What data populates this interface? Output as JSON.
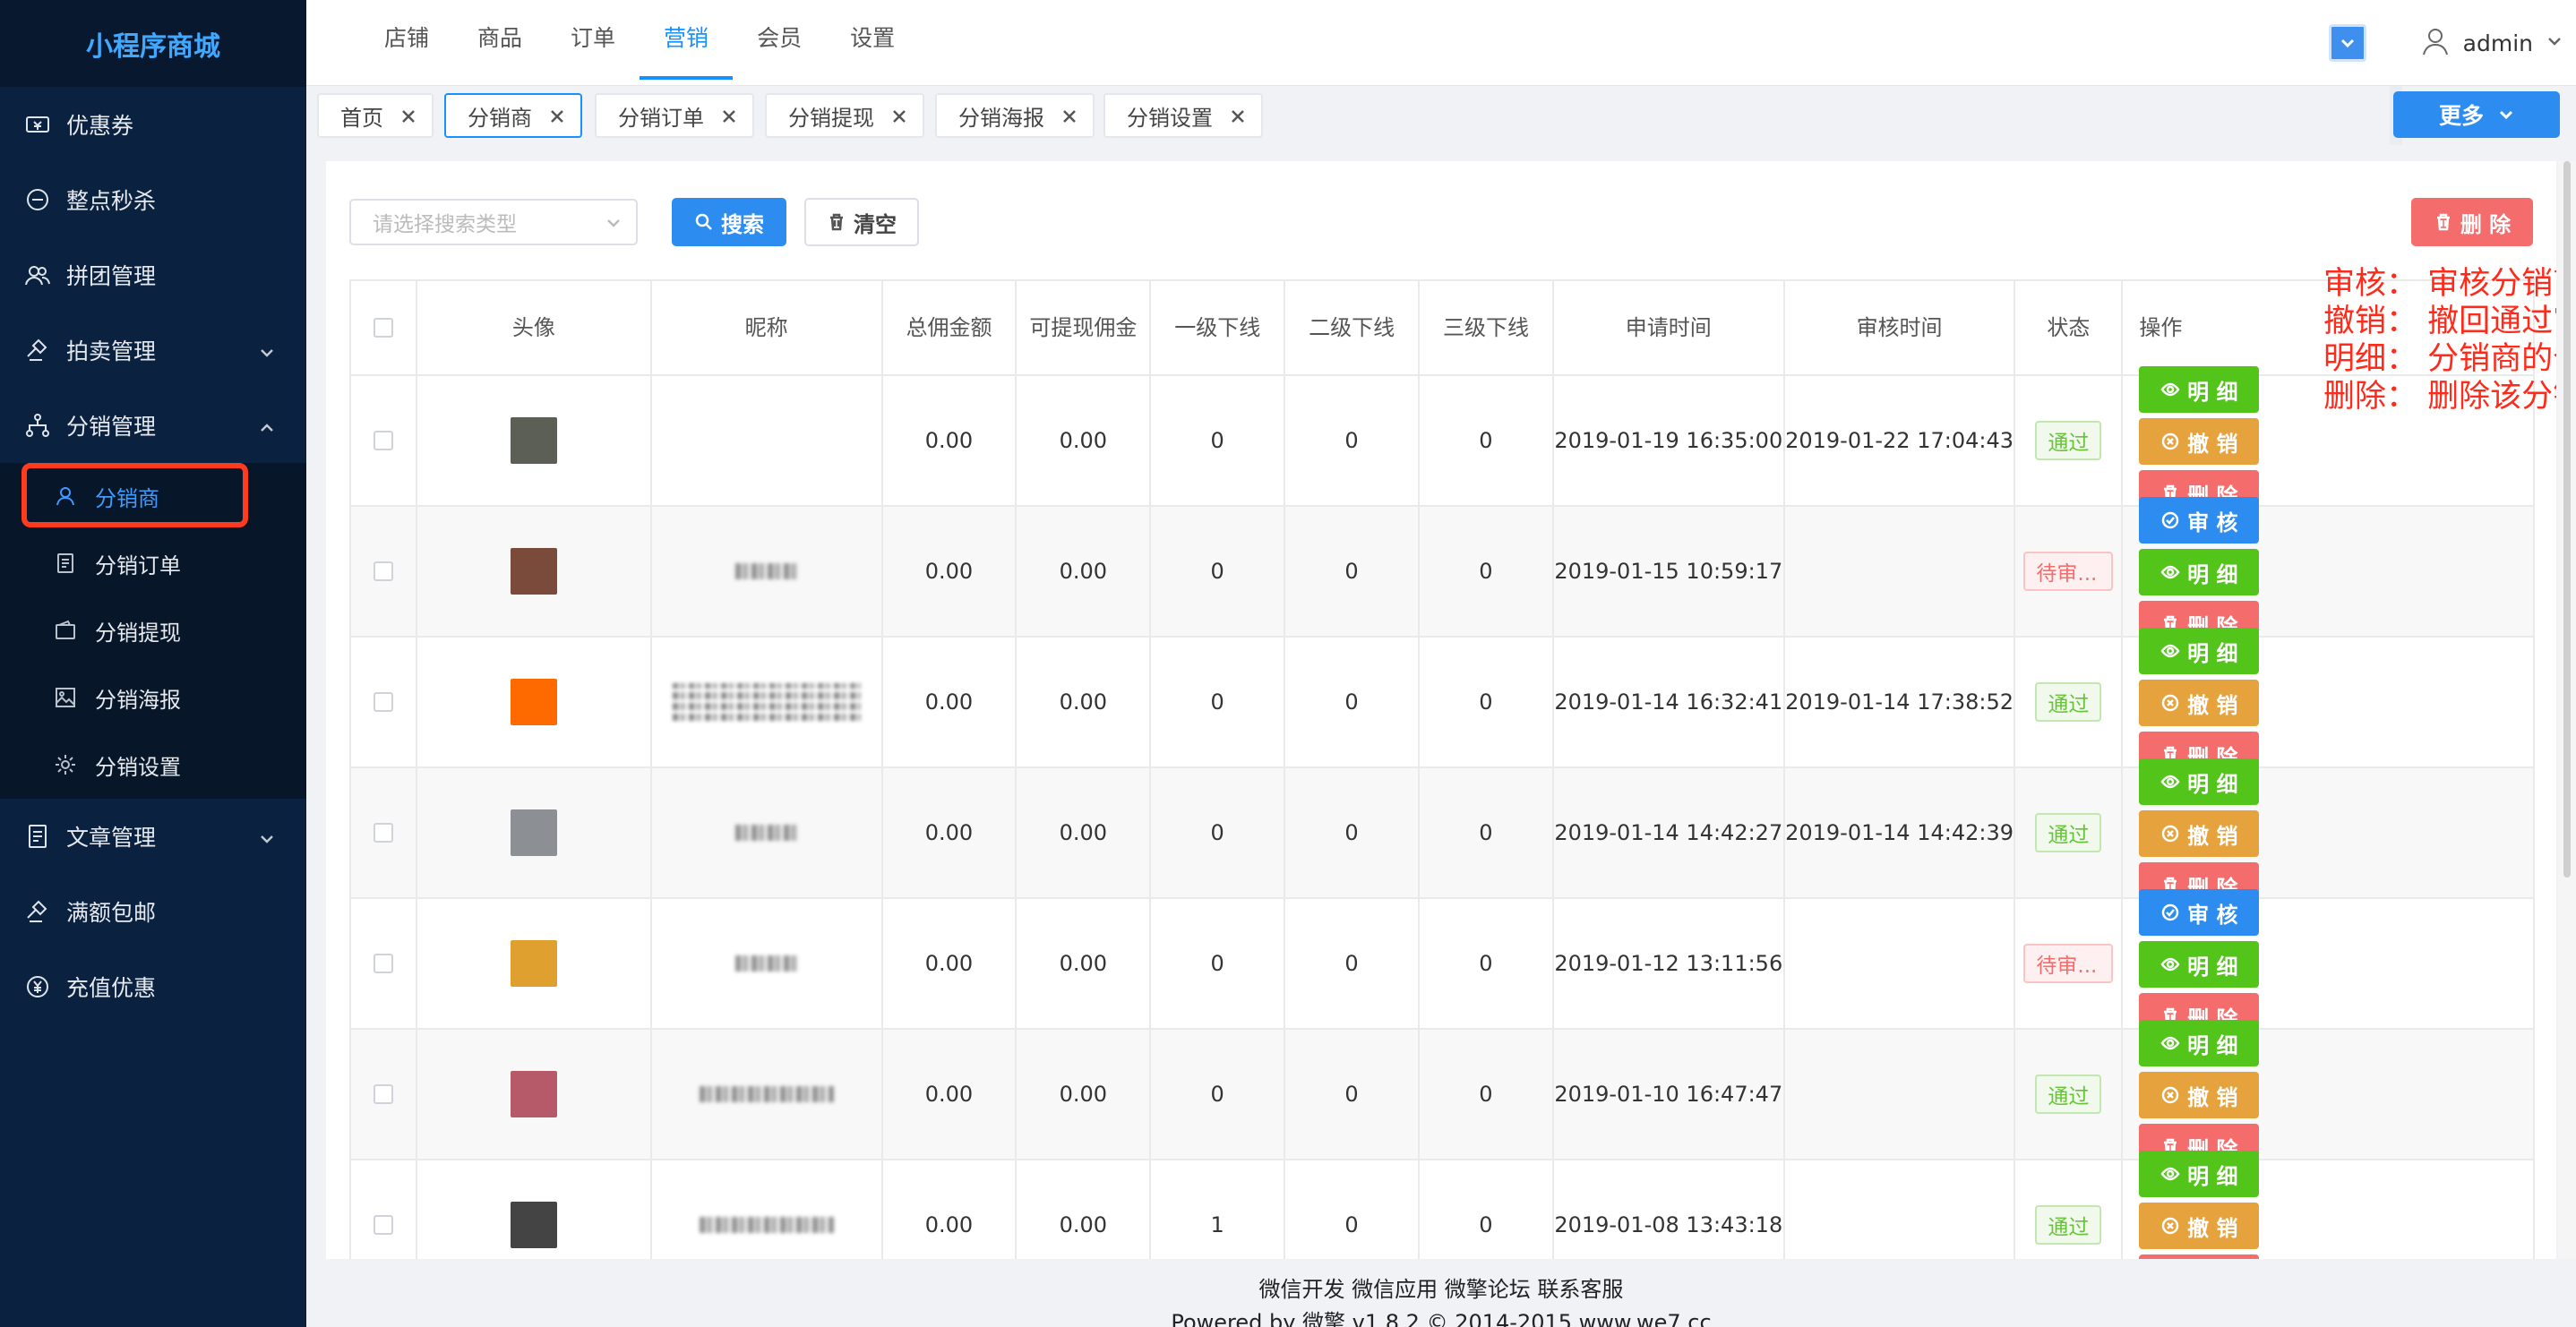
{
  "brand": "小程序商城",
  "sidebar": {
    "items": [
      {
        "label": "优惠券",
        "icon": "coupon-icon"
      },
      {
        "label": "整点秒杀",
        "icon": "flash-sale-icon"
      },
      {
        "label": "拼团管理",
        "icon": "group-icon"
      },
      {
        "label": "拍卖管理",
        "icon": "auction-icon"
      },
      {
        "label": "分销管理",
        "icon": "distribution-icon"
      },
      {
        "label": "文章管理",
        "icon": "article-icon"
      },
      {
        "label": "满额包邮",
        "icon": "shipping-icon"
      },
      {
        "label": "充值优惠",
        "icon": "recharge-icon"
      }
    ],
    "submenu": [
      {
        "label": "分销商",
        "icon": "user-icon"
      },
      {
        "label": "分销订单",
        "icon": "order-icon"
      },
      {
        "label": "分销提现",
        "icon": "wallet-icon"
      },
      {
        "label": "分销海报",
        "icon": "poster-icon"
      },
      {
        "label": "分销设置",
        "icon": "gear-icon"
      }
    ]
  },
  "header": {
    "nav": [
      "店铺",
      "商品",
      "订单",
      "营销",
      "会员",
      "设置"
    ],
    "active_nav": "营销",
    "user": "admin"
  },
  "tabs": [
    "首页",
    "分销商",
    "分销订单",
    "分销提现",
    "分销海报",
    "分销设置"
  ],
  "more_label": "更多",
  "toolbar": {
    "search_type_placeholder": "请选择搜索类型",
    "search_label": "搜索",
    "clear_label": "清空",
    "delete_label": "删 除"
  },
  "annotation": [
    "审核： 审核分销商的操作",
    "撤销： 撤回通过审核操作",
    "明细： 分销商的个人明细",
    "删除： 删除该分销商"
  ],
  "table": {
    "columns": [
      "头像",
      "昵称",
      "总佣金额",
      "可提现佣金",
      "一级下线",
      "二级下线",
      "三级下线",
      "申请时间",
      "审核时间",
      "状态",
      "操作"
    ],
    "rows": [
      {
        "total": "0.00",
        "withdrawable": "0.00",
        "l1": "0",
        "l2": "0",
        "l3": "0",
        "apply_time": "2019-01-19 16:35:00",
        "audit_time": "2019-01-22 17:04:43",
        "status": "通过"
      },
      {
        "total": "0.00",
        "withdrawable": "0.00",
        "l1": "0",
        "l2": "0",
        "l3": "0",
        "apply_time": "2019-01-15 10:59:17",
        "audit_time": "",
        "status": "待审..."
      },
      {
        "total": "0.00",
        "withdrawable": "0.00",
        "l1": "0",
        "l2": "0",
        "l3": "0",
        "apply_time": "2019-01-14 16:32:41",
        "audit_time": "2019-01-14 17:38:52",
        "status": "通过"
      },
      {
        "total": "0.00",
        "withdrawable": "0.00",
        "l1": "0",
        "l2": "0",
        "l3": "0",
        "apply_time": "2019-01-14 14:42:27",
        "audit_time": "2019-01-14 14:42:39",
        "status": "通过"
      },
      {
        "total": "0.00",
        "withdrawable": "0.00",
        "l1": "0",
        "l2": "0",
        "l3": "0",
        "apply_time": "2019-01-12 13:11:56",
        "audit_time": "",
        "status": "待审..."
      },
      {
        "total": "0.00",
        "withdrawable": "0.00",
        "l1": "0",
        "l2": "0",
        "l3": "0",
        "apply_time": "2019-01-10 16:47:47",
        "audit_time": "",
        "status": "通过"
      },
      {
        "total": "0.00",
        "withdrawable": "0.00",
        "l1": "1",
        "l2": "0",
        "l3": "0",
        "apply_time": "2019-01-08 13:43:18",
        "audit_time": "",
        "status": "通过"
      }
    ],
    "ops": {
      "detail": "明 细",
      "revoke": "撤 销",
      "delete": "删 除",
      "audit": "审 核"
    }
  },
  "footer": {
    "links": "微信开发 微信应用 微擎论坛 联系客服",
    "powered": "Powered by 微擎 v1.8.2 © 2014-2015 www.we7.cc"
  }
}
